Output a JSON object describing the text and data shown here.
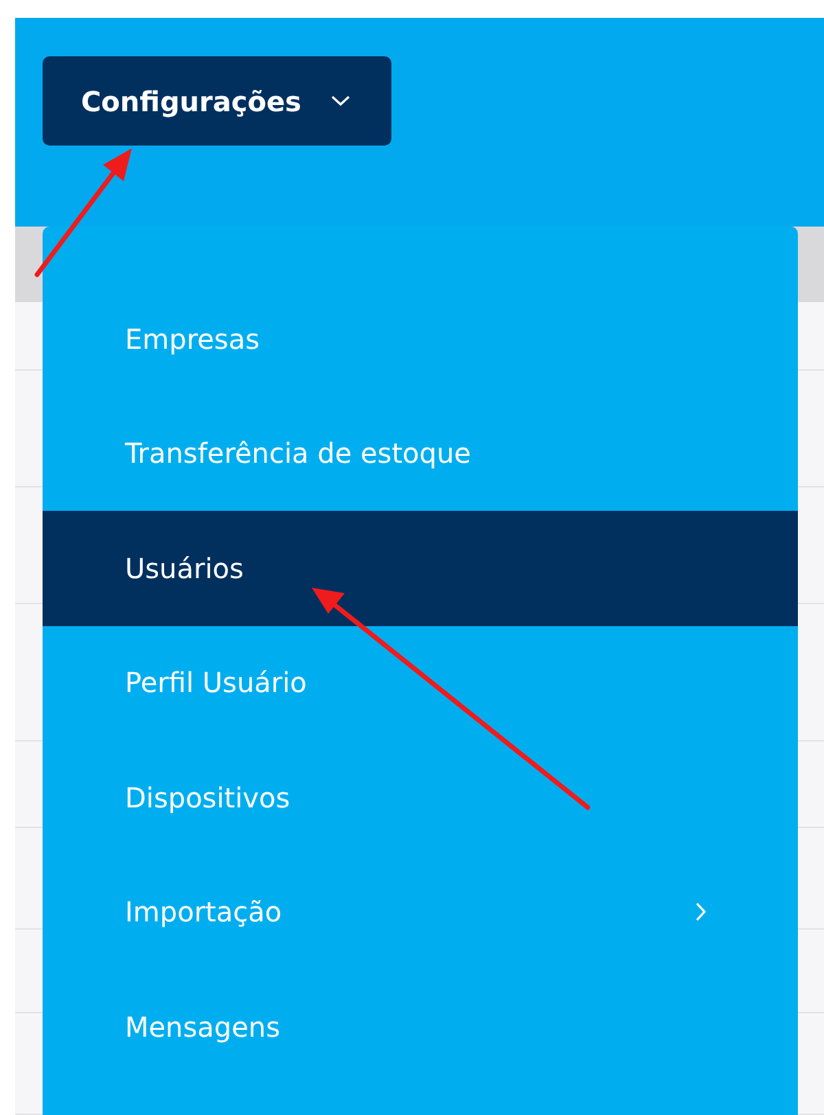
{
  "menu_button": {
    "label": "Configurações",
    "expanded": true
  },
  "menu": {
    "items": [
      {
        "label": "Empresas",
        "selected": false,
        "has_submenu": false
      },
      {
        "label": "Transferência de estoque",
        "selected": false,
        "has_submenu": false
      },
      {
        "label": "Usuários",
        "selected": true,
        "has_submenu": false
      },
      {
        "label": "Perfil Usuário",
        "selected": false,
        "has_submenu": false
      },
      {
        "label": "Dispositivos",
        "selected": false,
        "has_submenu": false
      },
      {
        "label": "Importação",
        "selected": false,
        "has_submenu": true
      },
      {
        "label": "Mensagens",
        "selected": false,
        "has_submenu": false
      }
    ]
  }
}
